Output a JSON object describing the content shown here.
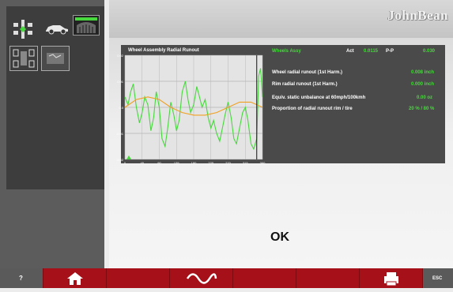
{
  "brand": "JohnBean",
  "chart": {
    "title": "Wheel Assembly Radial Runout",
    "y_ticks": [
      "0.02",
      "0.01",
      "0.0",
      "-0.01",
      "-0.02"
    ],
    "x_ticks": [
      "0",
      "45",
      "90",
      "135",
      "180",
      "225",
      "270",
      "315",
      "360"
    ]
  },
  "chart_data": {
    "type": "line",
    "title": "Wheel Assembly Radial Runout",
    "xlabel": "",
    "ylabel": "",
    "xlim": [
      0,
      360
    ],
    "ylim": [
      -0.02,
      0.02
    ],
    "x_ticks": [
      0,
      45,
      90,
      135,
      180,
      225,
      270,
      315,
      360
    ],
    "y_ticks": [
      0.02,
      0.01,
      0.0,
      -0.01,
      -0.02
    ],
    "grid": true,
    "marker_angle": 345,
    "series": [
      {
        "name": "",
        "color": "#46d83c",
        "x": [
          0,
          8,
          15,
          22,
          30,
          38,
          45,
          52,
          60,
          68,
          75,
          82,
          90,
          97,
          105,
          112,
          120,
          128,
          135,
          142,
          150,
          158,
          165,
          172,
          180,
          188,
          195,
          202,
          210,
          218,
          225,
          232,
          240,
          248,
          255,
          262,
          270,
          278,
          285,
          292,
          300,
          308,
          315,
          322,
          330,
          337,
          345,
          350,
          355,
          360
        ],
        "y": [
          0.004,
          0.001,
          0.006,
          0.009,
          0.0,
          -0.006,
          -0.002,
          0.004,
          0.001,
          -0.009,
          -0.004,
          0.006,
          0.0,
          -0.012,
          -0.015,
          -0.008,
          0.002,
          -0.003,
          -0.009,
          -0.005,
          0.006,
          0.01,
          0.003,
          -0.002,
          0.001,
          0.008,
          0.004,
          0.0,
          0.003,
          -0.004,
          -0.008,
          -0.005,
          -0.01,
          -0.013,
          -0.008,
          -0.003,
          0.002,
          -0.004,
          -0.012,
          -0.014,
          -0.008,
          -0.002,
          0.0,
          -0.005,
          -0.014,
          -0.016,
          -0.012,
          0.012,
          0.015,
          0.004
        ]
      },
      {
        "name": "",
        "color": "#f0a020",
        "x": [
          0,
          30,
          60,
          90,
          120,
          150,
          180,
          210,
          240,
          270,
          300,
          330,
          360
        ],
        "y": [
          0.0,
          0.003,
          0.004,
          0.003,
          0.0,
          -0.002,
          -0.003,
          -0.003,
          -0.002,
          0.0,
          0.002,
          0.002,
          0.0
        ]
      }
    ]
  },
  "info": {
    "header": {
      "label": "Wheels Assy",
      "act_label": "Act",
      "act_value": "0.0115",
      "pp_label": "P-P",
      "pp_value": "0.030"
    },
    "rows": [
      {
        "label": "Wheel radial runout (1st Harm.)",
        "value": "0.008 inch"
      },
      {
        "label": "Rim radial runout (1st Harm.)",
        "value": "0.000 inch"
      },
      {
        "label": "Equiv. static unbalance at 60mph/100kmh",
        "value": "0.00 oz"
      },
      {
        "label": "Proportion of radial runout rim / tire",
        "value": "20 % / 80 %"
      }
    ]
  },
  "status": "OK",
  "bottom": {
    "help": "?",
    "esc": "ESC"
  },
  "colors": {
    "accent": "#a61018",
    "series_green": "#46d83c",
    "series_orange": "#f0a020"
  }
}
